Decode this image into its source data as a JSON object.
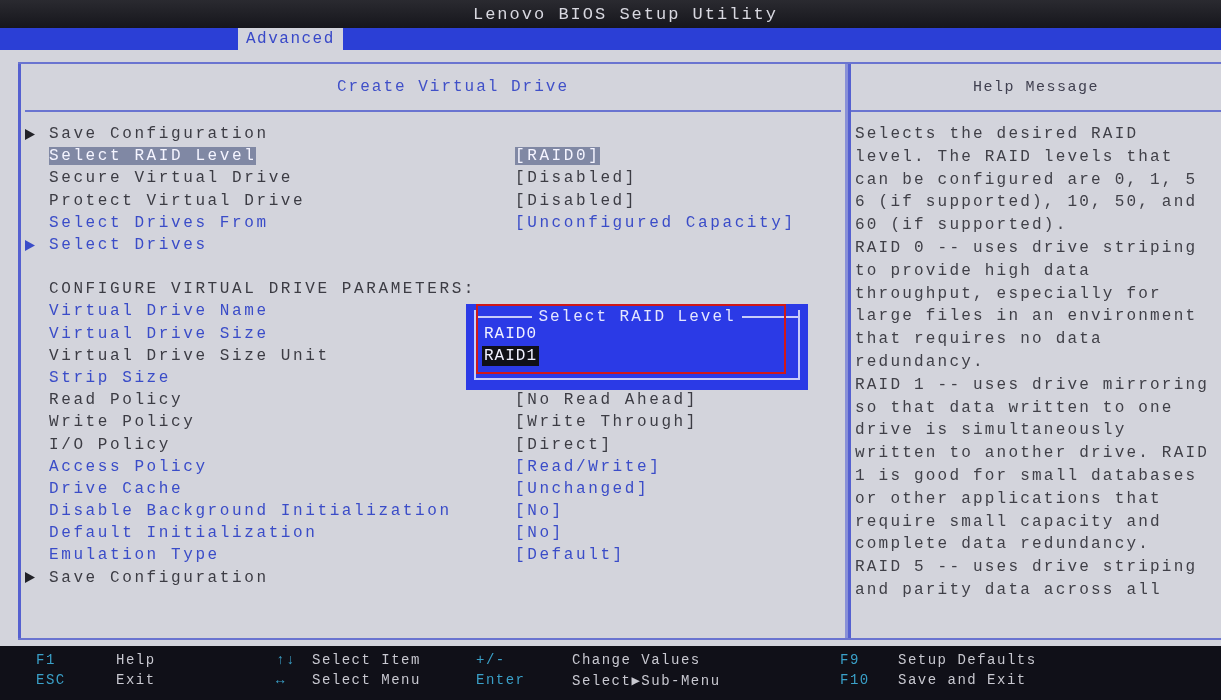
{
  "window": {
    "title": "Lenovo BIOS Setup Utility"
  },
  "tabs": [
    {
      "label": "Advanced",
      "selected": true
    }
  ],
  "settings_panel": {
    "title": "Create Virtual Drive",
    "rows": [
      {
        "kind": "submenu",
        "label": "Save Configuration",
        "selectable": false,
        "selected": false
      },
      {
        "kind": "setting",
        "label": "Select RAID Level",
        "value": "[RAID0]",
        "selectable": true,
        "selected": true
      },
      {
        "kind": "setting",
        "label": "Secure Virtual Drive",
        "value": "[Disabled]",
        "selectable": false,
        "selected": false
      },
      {
        "kind": "setting",
        "label": "Protect Virtual Drive",
        "value": "[Disabled]",
        "selectable": false,
        "selected": false
      },
      {
        "kind": "setting",
        "label": "Select Drives From",
        "value": "[Unconfigured Capacity]",
        "selectable": true,
        "selected": false
      },
      {
        "kind": "submenu",
        "label": "Select Drives",
        "selectable": true,
        "selected": false
      },
      {
        "kind": "heading",
        "label": "CONFIGURE VIRTUAL DRIVE PARAMETERS:"
      },
      {
        "kind": "setting",
        "label": "Virtual Drive Name",
        "selectable": true,
        "selected": false
      },
      {
        "kind": "setting",
        "label": "Virtual Drive Size",
        "selectable": true,
        "selected": false
      },
      {
        "kind": "setting",
        "label": "Virtual Drive Size Unit",
        "selectable": false,
        "selected": false
      },
      {
        "kind": "setting",
        "label": "Strip Size",
        "selectable": true,
        "selected": false
      },
      {
        "kind": "setting",
        "label": "Read Policy",
        "value": "[No Read Ahead]",
        "selectable": false,
        "selected": false
      },
      {
        "kind": "setting",
        "label": "Write Policy",
        "value": "[Write Through]",
        "selectable": false,
        "selected": false
      },
      {
        "kind": "setting",
        "label": "I/O Policy",
        "value": "[Direct]",
        "selectable": false,
        "selected": false
      },
      {
        "kind": "setting",
        "label": "Access Policy",
        "value": "[Read/Write]",
        "selectable": true,
        "selected": false
      },
      {
        "kind": "setting",
        "label": "Drive Cache",
        "value": "[Unchanged]",
        "selectable": true,
        "selected": false
      },
      {
        "kind": "setting",
        "label": "Disable Background Initialization",
        "value": "[No]",
        "selectable": true,
        "selected": false
      },
      {
        "kind": "setting",
        "label": "Default Initialization",
        "value": "[No]",
        "selectable": true,
        "selected": false
      },
      {
        "kind": "setting",
        "label": "Emulation Type",
        "value": "[Default]",
        "selectable": true,
        "selected": false
      },
      {
        "kind": "submenu",
        "label": "Save Configuration",
        "selectable": false,
        "selected": false
      }
    ]
  },
  "popup": {
    "title": "Select RAID Level",
    "annotation_box": true,
    "options": [
      {
        "label": "RAID0",
        "selected": false
      },
      {
        "label": "RAID1",
        "selected": true
      }
    ]
  },
  "help_panel": {
    "title": "Help Message",
    "lines": [
      "Selects the desired RAID",
      "level. The RAID levels that",
      "can be configured are 0, 1, 5",
      "6 (if supported), 10, 50, and",
      "60 (if supported).",
      "RAID 0 -- uses drive striping",
      "to provide high data",
      "throughput, especially for",
      "large files in an environment",
      "that requires no data",
      "redundancy.",
      "RAID 1 -- uses drive mirroring",
      "so that data written to one",
      "drive is simultaneously",
      "written to another drive. RAID",
      "1 is good for small databases",
      "or other applications that",
      "require small capacity and",
      "complete data redundancy.",
      "RAID 5 -- uses drive striping",
      "and parity data across all"
    ]
  },
  "key_bar": [
    {
      "key": "F1",
      "action": "Help"
    },
    {
      "key": "ESC",
      "action": "Exit"
    },
    {
      "key": "↑↓",
      "action": "Select Item"
    },
    {
      "key": "↔",
      "action": "Select Menu"
    },
    {
      "key": "+/-",
      "action": "Change Values"
    },
    {
      "key": "Enter",
      "action": "Select▶Sub-Menu"
    },
    {
      "key": "F9",
      "action": "Setup Defaults"
    },
    {
      "key": "F10",
      "action": "Save and Exit"
    }
  ]
}
